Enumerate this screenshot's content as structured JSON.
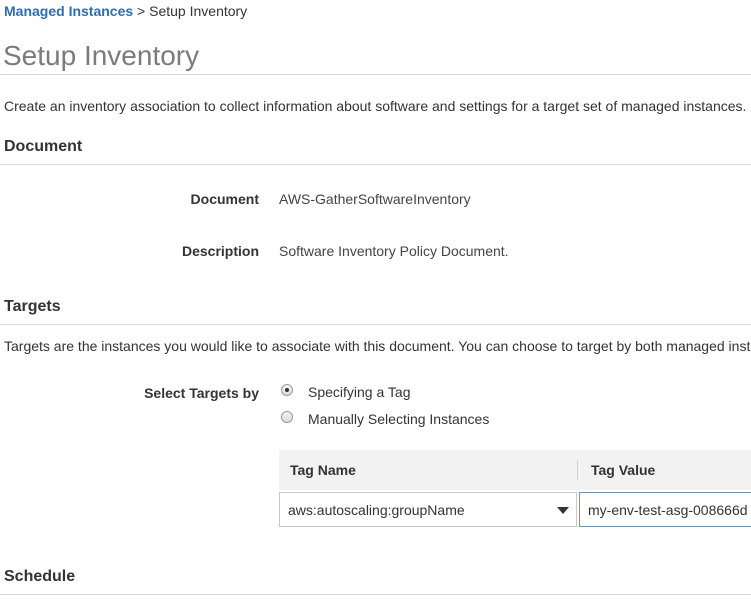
{
  "breadcrumb": {
    "parent": "Managed Instances",
    "separator": ">",
    "current": "Setup Inventory"
  },
  "page_title": "Setup Inventory",
  "intro": "Create an inventory association to collect information about software and settings for a target set of managed instances.",
  "document_section": {
    "heading": "Document",
    "document_label": "Document",
    "document_value": "AWS-GatherSoftwareInventory",
    "description_label": "Description",
    "description_value": "Software Inventory Policy Document."
  },
  "targets_section": {
    "heading": "Targets",
    "intro": "Targets are the instances you would like to associate with this document. You can choose to target by both managed instances",
    "select_label": "Select Targets by",
    "options": [
      {
        "label": "Specifying a Tag",
        "selected": true
      },
      {
        "label": "Manually Selecting Instances",
        "selected": false
      }
    ],
    "tag_table": {
      "col_tag_name": "Tag Name",
      "col_tag_value": "Tag Value",
      "tag_name_selected": "aws:autoscaling:groupName",
      "tag_value": "my-env-test-asg-008666d"
    }
  },
  "schedule_section": {
    "heading": "Schedule"
  },
  "colors": {
    "link": "#2d6db0",
    "title_gray": "#7b7b7b",
    "input_focus": "#5b9bd5"
  }
}
